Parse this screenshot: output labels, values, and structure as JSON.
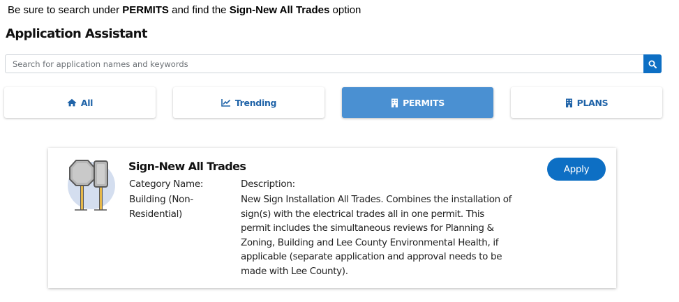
{
  "instruction": {
    "prefix": "Be sure to search under ",
    "strong1": "PERMITS",
    "middle": " and find the ",
    "strong2": "Sign-New All Trades",
    "suffix": " option"
  },
  "page_title": "Application Assistant",
  "search": {
    "placeholder": "Search for application names and keywords",
    "value": "",
    "icon": "search-icon"
  },
  "tabs": [
    {
      "label": "All",
      "icon": "home-icon",
      "active": false
    },
    {
      "label": "Trending",
      "icon": "line-chart-icon",
      "active": false
    },
    {
      "label": "PERMITS",
      "icon": "building-icon",
      "active": true
    },
    {
      "label": "PLANS",
      "icon": "building-icon",
      "active": false
    }
  ],
  "result": {
    "icon": "sign-icon",
    "title": "Sign-New All Trades",
    "category_label": "Category Name:",
    "category_value": "Building (Non-Residential)",
    "description_label": "Description:",
    "description": "New Sign Installation All Trades. Combines the installation of sign(s) with the electrical trades all in one permit. This permit includes the simultaneous reviews for Planning & Zoning, Building and Lee County Environmental Health, if applicable (separate application and approval needs to be made with Lee County).",
    "apply_label": "Apply"
  },
  "colors": {
    "accent": "#0d6fc4",
    "active_tab": "#4a90d2",
    "tab_text": "#1f63a8"
  }
}
